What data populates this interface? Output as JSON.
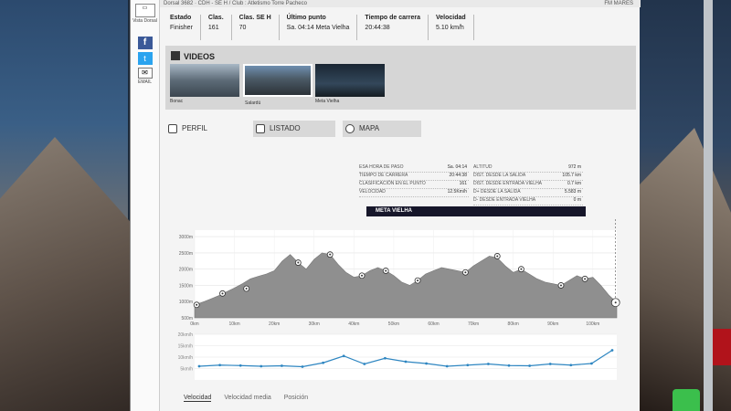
{
  "topbar": {
    "breadcrumb": "Dorsal 3682 · CDH - SE H   /   Club : Atletismo Torre Pacheco",
    "right": "FM MARES"
  },
  "rail": {
    "btn_label": "Vista Dorsal",
    "mail_label": "EMAIL",
    "fb": "f",
    "tw": "t"
  },
  "stats": [
    {
      "h": "Estado",
      "v": "Finisher"
    },
    {
      "h": "Clas.",
      "v": "161"
    },
    {
      "h": "Clas. SE H",
      "v": "70"
    },
    {
      "h": "Último punto",
      "v": "Sa. 04:14   Meta Vielha"
    },
    {
      "h": "Tiempo de carrera",
      "v": "20:44:38"
    },
    {
      "h": "Velocidad",
      "v": "5.10 km/h"
    }
  ],
  "videos": {
    "title": "VIDEOS",
    "items": [
      {
        "caption": "Bonac"
      },
      {
        "caption": "Salardú"
      },
      {
        "caption": "Meta Vielha"
      }
    ]
  },
  "tabs": {
    "perfil": "PERFIL",
    "listado": "LISTADO",
    "mapa": "MAPA"
  },
  "info": {
    "left": [
      {
        "k": "ESA HORA DE PASO",
        "v": "Sa. 04:14"
      },
      {
        "k": "TIEMPO DE CARRERA",
        "v": "20:44:38"
      },
      {
        "k": "CLASIFICACIÓN EN EL PUNTO",
        "v": "161"
      },
      {
        "k": "VELOCIDAD",
        "v": "12.5Km/h"
      }
    ],
    "right": [
      {
        "k": "ALTITUD",
        "v": "972 m"
      },
      {
        "k": "DIST. DESDE LA SALIDA",
        "v": "105.7 km"
      },
      {
        "k": "DIST. DESDE ENTRADA VIELHA",
        "v": "0.7 km"
      },
      {
        "k": "D+ DESDE LA SALIDA",
        "v": "5.583 m"
      },
      {
        "k": "D- DESDE ENTRADA VIELHA",
        "v": "0 m"
      }
    ]
  },
  "banner": "META VIELHA",
  "chart_data": [
    {
      "type": "area",
      "title": "",
      "xlabel": "",
      "ylabel": "",
      "x_ticks": [
        "0km",
        "10km",
        "20km",
        "30km",
        "40km",
        "50km",
        "60km",
        "70km",
        "80km",
        "90km",
        "100km"
      ],
      "y_ticks": [
        "500m",
        "1000m",
        "1500m",
        "2000m",
        "2500m",
        "3000m"
      ],
      "xlim": [
        0,
        106
      ],
      "ylim": [
        500,
        3200
      ],
      "series": [
        {
          "x": [
            0,
            2,
            4,
            6,
            8,
            10,
            12,
            14,
            16,
            18,
            20,
            22,
            24,
            26,
            28,
            30,
            32,
            34,
            36,
            38,
            40,
            42,
            44,
            46,
            48,
            50,
            52,
            54,
            56,
            58,
            60,
            62,
            64,
            66,
            68,
            70,
            72,
            74,
            76,
            78,
            80,
            82,
            84,
            86,
            88,
            90,
            92,
            94,
            96,
            98,
            100,
            102,
            104,
            106
          ],
          "y": [
            900,
            980,
            1080,
            1180,
            1300,
            1420,
            1550,
            1700,
            1780,
            1850,
            1950,
            2250,
            2450,
            2200,
            2000,
            2300,
            2500,
            2450,
            2150,
            1900,
            1750,
            1800,
            1950,
            2050,
            1950,
            1800,
            1600,
            1500,
            1650,
            1850,
            1950,
            2050,
            2000,
            1950,
            1900,
            2100,
            2250,
            2400,
            2350,
            2100,
            1900,
            2000,
            1850,
            1700,
            1600,
            1550,
            1500,
            1650,
            1800,
            1700,
            1750,
            1500,
            1200,
            972
          ]
        }
      ],
      "checkpoints": [
        {
          "x": 0.5,
          "y": 900
        },
        {
          "x": 7,
          "y": 1250
        },
        {
          "x": 13,
          "y": 1400
        },
        {
          "x": 26,
          "y": 2200
        },
        {
          "x": 34,
          "y": 2450
        },
        {
          "x": 42,
          "y": 1800
        },
        {
          "x": 48,
          "y": 1950
        },
        {
          "x": 56,
          "y": 1650
        },
        {
          "x": 68,
          "y": 1900
        },
        {
          "x": 76,
          "y": 2400
        },
        {
          "x": 82,
          "y": 2000
        },
        {
          "x": 92,
          "y": 1500
        },
        {
          "x": 98,
          "y": 1700
        },
        {
          "x": 105.7,
          "y": 972
        }
      ],
      "grid": true
    },
    {
      "type": "line",
      "title": "",
      "y_ticks": [
        "5km/h",
        "10km/h",
        "15km/h",
        "20km/h"
      ],
      "ylim": [
        0,
        20
      ],
      "series": [
        {
          "name": "Velocidad",
          "x": [
            1,
            2,
            3,
            4,
            5,
            6,
            7,
            8,
            9,
            10,
            11,
            12,
            13,
            14,
            15,
            16,
            17,
            18,
            19,
            20,
            21
          ],
          "y": [
            6,
            6.5,
            6.3,
            6.0,
            6.2,
            5.8,
            7.5,
            10.5,
            7.0,
            9.5,
            8.0,
            7.2,
            6.0,
            6.5,
            7.0,
            6.3,
            6.2,
            7.0,
            6.5,
            7.2,
            13.0
          ]
        }
      ],
      "grid": true
    }
  ],
  "legend": {
    "velocidad": "Velocidad",
    "velocidad_media": "Velocidad media",
    "posicion": "Posición"
  }
}
